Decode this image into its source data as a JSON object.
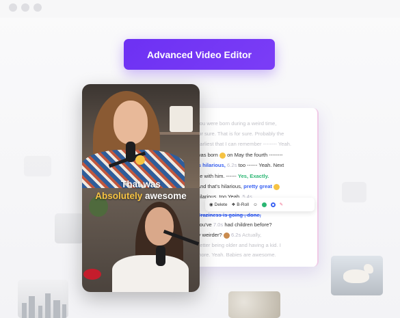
{
  "cta": {
    "label": "Advanced Video Editor"
  },
  "caption": {
    "line1": "That was",
    "word_highlight": "Absolutely",
    "word_rest": "awesome"
  },
  "transcript": {
    "lines": [
      {
        "text": "you were born during a weird time,",
        "style": "faded"
      },
      {
        "text": "for sure. That is for sure. Probably the",
        "style": "faded"
      },
      {
        "text": "earliest that I can remember  --------  Yeah.",
        "style": "faded"
      },
      {
        "pre": "was born",
        "post": "on May the fourth  --------"
      },
      {
        "highlight": "'s hilarious,",
        "ts": "6.2s",
        "post": "too  ------  Yeah. Next"
      },
      {
        "pre": "be with him.  ------",
        "green": "Yes, Exactly."
      },
      {
        "pre": "And that's hilarious,",
        "blue": "pretty great"
      },
      {
        "pre": "hilarious, too.Yeah,",
        "ts": "5.4s"
      },
      {
        "strike": "Craziness is going , done,"
      },
      {
        "pre": "you've",
        "ts": "7.0s",
        "post": "had children before?"
      },
      {
        "pre": "ly weirder?",
        "ts": "6.2s",
        "post": "Actually,"
      },
      {
        "text": "better being older and having a kid. I",
        "style": "faded"
      },
      {
        "text": "more. Yeah. Babies are awesome.",
        "style": "faded"
      }
    ]
  },
  "toolbar": {
    "delete": "Delete",
    "broll": "B-Roll"
  },
  "colors": {
    "accent": "#6d31f3",
    "blue": "#3a62f2",
    "green": "#2bb673",
    "gold": "#f6c343"
  }
}
